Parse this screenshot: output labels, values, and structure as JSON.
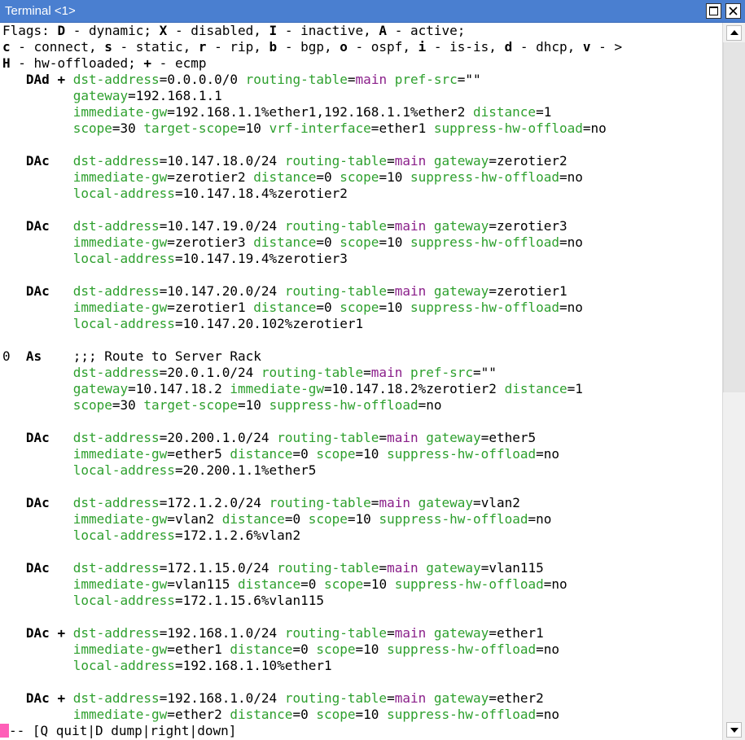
{
  "window": {
    "title": "Terminal <1>"
  },
  "flags": {
    "line1": [
      [
        "t",
        "Flags: "
      ],
      [
        "f",
        "D"
      ],
      [
        "t",
        " - dynamic; "
      ],
      [
        "f",
        "X"
      ],
      [
        "t",
        " - disabled, "
      ],
      [
        "f",
        "I"
      ],
      [
        "t",
        " - inactive, "
      ],
      [
        "f",
        "A"
      ],
      [
        "t",
        " - active;"
      ]
    ],
    "line2": [
      [
        "f",
        "c"
      ],
      [
        "t",
        " - connect, "
      ],
      [
        "f",
        "s"
      ],
      [
        "t",
        " - static, "
      ],
      [
        "f",
        "r"
      ],
      [
        "t",
        " - rip, "
      ],
      [
        "f",
        "b"
      ],
      [
        "t",
        " - bgp, "
      ],
      [
        "f",
        "o"
      ],
      [
        "t",
        " - ospf, "
      ],
      [
        "f",
        "i"
      ],
      [
        "t",
        " - is-is, "
      ],
      [
        "f",
        "d"
      ],
      [
        "t",
        " - dhcp, "
      ],
      [
        "f",
        "v"
      ],
      [
        "t",
        " - >"
      ]
    ],
    "line3": [
      [
        "f",
        "H"
      ],
      [
        "t",
        " - hw-offloaded; "
      ],
      [
        "f",
        "+"
      ],
      [
        "t",
        " - ecmp"
      ]
    ]
  },
  "routes": [
    {
      "num": "",
      "flags": "DAd +",
      "lines": [
        [
          [
            "k",
            "dst-address"
          ],
          [
            "v",
            "0.0.0.0/0"
          ],
          [
            "k",
            "routing-table"
          ],
          [
            "p",
            "main"
          ],
          [
            "k",
            "pref-src"
          ],
          [
            "v",
            "\"\""
          ]
        ],
        [
          [
            "k",
            "gateway"
          ],
          [
            "v",
            "192.168.1.1"
          ]
        ],
        [
          [
            "k",
            "immediate-gw"
          ],
          [
            "v",
            "192.168.1.1%ether1,192.168.1.1%ether2"
          ],
          [
            "k",
            "distance"
          ],
          [
            "v",
            "1"
          ]
        ],
        [
          [
            "k",
            "scope"
          ],
          [
            "v",
            "30"
          ],
          [
            "k",
            "target-scope"
          ],
          [
            "v",
            "10"
          ],
          [
            "k",
            "vrf-interface"
          ],
          [
            "v",
            "ether1"
          ],
          [
            "k",
            "suppress-hw-offload"
          ],
          [
            "v",
            "no"
          ]
        ]
      ]
    },
    {
      "num": "",
      "flags": "DAc",
      "lines": [
        [
          [
            "k",
            "dst-address"
          ],
          [
            "v",
            "10.147.18.0/24"
          ],
          [
            "k",
            "routing-table"
          ],
          [
            "p",
            "main"
          ],
          [
            "k",
            "gateway"
          ],
          [
            "v",
            "zerotier2"
          ]
        ],
        [
          [
            "k",
            "immediate-gw"
          ],
          [
            "v",
            "zerotier2"
          ],
          [
            "k",
            "distance"
          ],
          [
            "v",
            "0"
          ],
          [
            "k",
            "scope"
          ],
          [
            "v",
            "10"
          ],
          [
            "k",
            "suppress-hw-offload"
          ],
          [
            "v",
            "no"
          ]
        ],
        [
          [
            "k",
            "local-address"
          ],
          [
            "v",
            "10.147.18.4%zerotier2"
          ]
        ]
      ]
    },
    {
      "num": "",
      "flags": "DAc",
      "lines": [
        [
          [
            "k",
            "dst-address"
          ],
          [
            "v",
            "10.147.19.0/24"
          ],
          [
            "k",
            "routing-table"
          ],
          [
            "p",
            "main"
          ],
          [
            "k",
            "gateway"
          ],
          [
            "v",
            "zerotier3"
          ]
        ],
        [
          [
            "k",
            "immediate-gw"
          ],
          [
            "v",
            "zerotier3"
          ],
          [
            "k",
            "distance"
          ],
          [
            "v",
            "0"
          ],
          [
            "k",
            "scope"
          ],
          [
            "v",
            "10"
          ],
          [
            "k",
            "suppress-hw-offload"
          ],
          [
            "v",
            "no"
          ]
        ],
        [
          [
            "k",
            "local-address"
          ],
          [
            "v",
            "10.147.19.4%zerotier3"
          ]
        ]
      ]
    },
    {
      "num": "",
      "flags": "DAc",
      "lines": [
        [
          [
            "k",
            "dst-address"
          ],
          [
            "v",
            "10.147.20.0/24"
          ],
          [
            "k",
            "routing-table"
          ],
          [
            "p",
            "main"
          ],
          [
            "k",
            "gateway"
          ],
          [
            "v",
            "zerotier1"
          ]
        ],
        [
          [
            "k",
            "immediate-gw"
          ],
          [
            "v",
            "zerotier1"
          ],
          [
            "k",
            "distance"
          ],
          [
            "v",
            "0"
          ],
          [
            "k",
            "scope"
          ],
          [
            "v",
            "10"
          ],
          [
            "k",
            "suppress-hw-offload"
          ],
          [
            "v",
            "no"
          ]
        ],
        [
          [
            "k",
            "local-address"
          ],
          [
            "v",
            "10.147.20.102%zerotier1"
          ]
        ]
      ]
    },
    {
      "num": "0",
      "flags": "As",
      "lines": [
        [
          [
            "c",
            ";;; Route to Server Rack"
          ]
        ],
        [
          [
            "k",
            "dst-address"
          ],
          [
            "v",
            "20.0.1.0/24"
          ],
          [
            "k",
            "routing-table"
          ],
          [
            "p",
            "main"
          ],
          [
            "k",
            "pref-src"
          ],
          [
            "v",
            "\"\""
          ]
        ],
        [
          [
            "k",
            "gateway"
          ],
          [
            "v",
            "10.147.18.2"
          ],
          [
            "k",
            "immediate-gw"
          ],
          [
            "v",
            "10.147.18.2%zerotier2"
          ],
          [
            "k",
            "distance"
          ],
          [
            "v",
            "1"
          ]
        ],
        [
          [
            "k",
            "scope"
          ],
          [
            "v",
            "30"
          ],
          [
            "k",
            "target-scope"
          ],
          [
            "v",
            "10"
          ],
          [
            "k",
            "suppress-hw-offload"
          ],
          [
            "v",
            "no"
          ]
        ]
      ]
    },
    {
      "num": "",
      "flags": "DAc",
      "lines": [
        [
          [
            "k",
            "dst-address"
          ],
          [
            "v",
            "20.200.1.0/24"
          ],
          [
            "k",
            "routing-table"
          ],
          [
            "p",
            "main"
          ],
          [
            "k",
            "gateway"
          ],
          [
            "v",
            "ether5"
          ]
        ],
        [
          [
            "k",
            "immediate-gw"
          ],
          [
            "v",
            "ether5"
          ],
          [
            "k",
            "distance"
          ],
          [
            "v",
            "0"
          ],
          [
            "k",
            "scope"
          ],
          [
            "v",
            "10"
          ],
          [
            "k",
            "suppress-hw-offload"
          ],
          [
            "v",
            "no"
          ]
        ],
        [
          [
            "k",
            "local-address"
          ],
          [
            "v",
            "20.200.1.1%ether5"
          ]
        ]
      ]
    },
    {
      "num": "",
      "flags": "DAc",
      "lines": [
        [
          [
            "k",
            "dst-address"
          ],
          [
            "v",
            "172.1.2.0/24"
          ],
          [
            "k",
            "routing-table"
          ],
          [
            "p",
            "main"
          ],
          [
            "k",
            "gateway"
          ],
          [
            "v",
            "vlan2"
          ]
        ],
        [
          [
            "k",
            "immediate-gw"
          ],
          [
            "v",
            "vlan2"
          ],
          [
            "k",
            "distance"
          ],
          [
            "v",
            "0"
          ],
          [
            "k",
            "scope"
          ],
          [
            "v",
            "10"
          ],
          [
            "k",
            "suppress-hw-offload"
          ],
          [
            "v",
            "no"
          ]
        ],
        [
          [
            "k",
            "local-address"
          ],
          [
            "v",
            "172.1.2.6%vlan2"
          ]
        ]
      ]
    },
    {
      "num": "",
      "flags": "DAc",
      "lines": [
        [
          [
            "k",
            "dst-address"
          ],
          [
            "v",
            "172.1.15.0/24"
          ],
          [
            "k",
            "routing-table"
          ],
          [
            "p",
            "main"
          ],
          [
            "k",
            "gateway"
          ],
          [
            "v",
            "vlan115"
          ]
        ],
        [
          [
            "k",
            "immediate-gw"
          ],
          [
            "v",
            "vlan115"
          ],
          [
            "k",
            "distance"
          ],
          [
            "v",
            "0"
          ],
          [
            "k",
            "scope"
          ],
          [
            "v",
            "10"
          ],
          [
            "k",
            "suppress-hw-offload"
          ],
          [
            "v",
            "no"
          ]
        ],
        [
          [
            "k",
            "local-address"
          ],
          [
            "v",
            "172.1.15.6%vlan115"
          ]
        ]
      ]
    },
    {
      "num": "",
      "flags": "DAc +",
      "lines": [
        [
          [
            "k",
            "dst-address"
          ],
          [
            "v",
            "192.168.1.0/24"
          ],
          [
            "k",
            "routing-table"
          ],
          [
            "p",
            "main"
          ],
          [
            "k",
            "gateway"
          ],
          [
            "v",
            "ether1"
          ]
        ],
        [
          [
            "k",
            "immediate-gw"
          ],
          [
            "v",
            "ether1"
          ],
          [
            "k",
            "distance"
          ],
          [
            "v",
            "0"
          ],
          [
            "k",
            "scope"
          ],
          [
            "v",
            "10"
          ],
          [
            "k",
            "suppress-hw-offload"
          ],
          [
            "v",
            "no"
          ]
        ],
        [
          [
            "k",
            "local-address"
          ],
          [
            "v",
            "192.168.1.10%ether1"
          ]
        ]
      ]
    },
    {
      "num": "",
      "flags": "DAc +",
      "lines": [
        [
          [
            "k",
            "dst-address"
          ],
          [
            "v",
            "192.168.1.0/24"
          ],
          [
            "k",
            "routing-table"
          ],
          [
            "p",
            "main"
          ],
          [
            "k",
            "gateway"
          ],
          [
            "v",
            "ether2"
          ]
        ],
        [
          [
            "k",
            "immediate-gw"
          ],
          [
            "v",
            "ether2"
          ],
          [
            "k",
            "distance"
          ],
          [
            "v",
            "0"
          ],
          [
            "k",
            "scope"
          ],
          [
            "v",
            "10"
          ],
          [
            "k",
            "suppress-hw-offload"
          ],
          [
            "v",
            "no"
          ]
        ]
      ]
    }
  ],
  "status_bar": {
    "text": "-- [Q quit|D dump|right|down]"
  },
  "colors": {
    "key": "#2ea02e",
    "table": "#8a1f8a",
    "titlebar": "#4a7fd0",
    "cursor": "#ff5fb8"
  },
  "icons": {
    "maximize": "maximize-icon",
    "close": "close-icon",
    "scroll_up": "arrow-up-icon",
    "scroll_down": "arrow-down-icon"
  }
}
